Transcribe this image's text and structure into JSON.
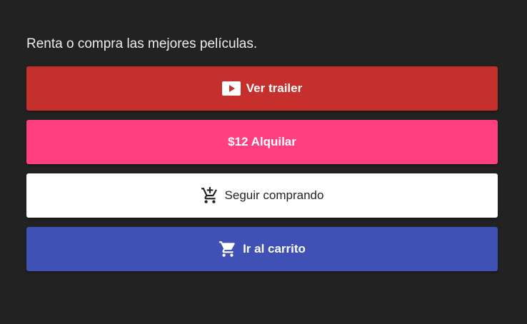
{
  "subtitle": "Renta o compra las mejores películas.",
  "buttons": {
    "trailer": {
      "label": "Ver trailer",
      "icon": "youtube-play-icon",
      "color": "#c5302c"
    },
    "rent": {
      "label": "$12 Alquilar",
      "color": "#ff3f80"
    },
    "continue": {
      "label": "Seguir comprando",
      "icon": "add-shopping-cart-icon",
      "color": "#ffffff"
    },
    "cart": {
      "label": "Ir al carrito",
      "icon": "shopping-cart-icon",
      "color": "#3f51b5"
    }
  },
  "colors": {
    "background": "#222222"
  }
}
